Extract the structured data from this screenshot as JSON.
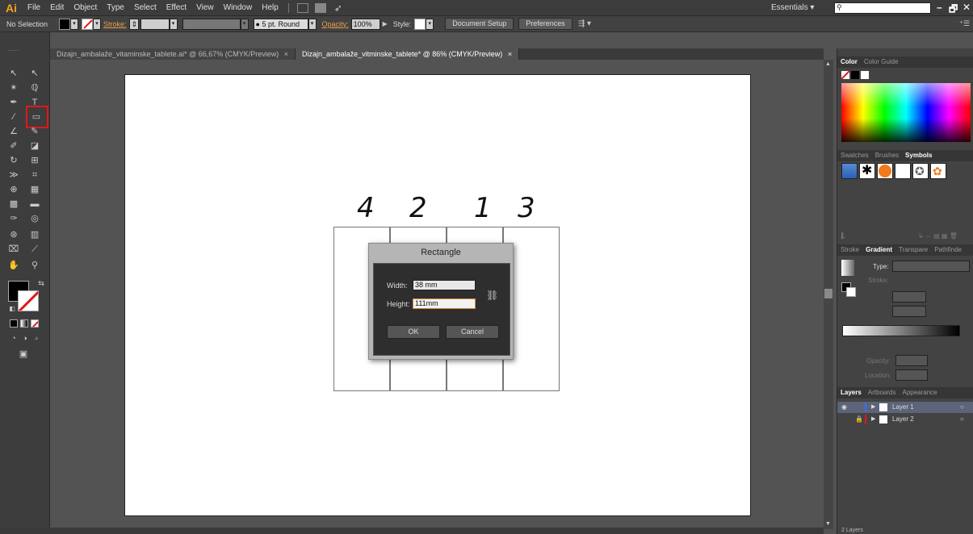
{
  "menubar": {
    "logo": "Ai",
    "items": [
      "File",
      "Edit",
      "Object",
      "Type",
      "Select",
      "Effect",
      "View",
      "Window",
      "Help"
    ],
    "workspace": "Essentials",
    "controls": [
      "–",
      "🗗",
      "✕"
    ]
  },
  "optbar": {
    "selection": "No Selection",
    "stroke_label": "Stroke:",
    "brush": "5 pt. Round",
    "opacity_label": "Opacity:",
    "opacity_value": "100%",
    "style_label": "Style:",
    "document_setup": "Document Setup",
    "preferences": "Preferences"
  },
  "tabs": [
    {
      "label": "Dizajn_ambalaže_vitaminske_tablete.ai* @ 66,67% (CMYK/Preview)",
      "close": "×"
    },
    {
      "label": "Dizajn_ambalaže_vitminske_tablete* @ 86% (CMYK/Preview)",
      "close": "×"
    }
  ],
  "artboard": {
    "digits": [
      "4",
      "2",
      "1",
      "3"
    ]
  },
  "dialog": {
    "title": "Rectangle",
    "width_label": "Width:",
    "width_value": "38 mm",
    "height_label": "Height:",
    "height_value": "111mm",
    "ok": "OK",
    "cancel": "Cancel"
  },
  "panels": {
    "color_tabs": [
      "Color",
      "Color Guide"
    ],
    "swatch_tabs": [
      "Swatches",
      "Brushes",
      "Symbols"
    ],
    "gradient_tabs": [
      "Stroke",
      "Gradient",
      "Transpare",
      "Pathfinde"
    ],
    "type_label": "Type:",
    "stroke_label": "Stroke:",
    "opacity_label": "Opacity:",
    "location_label": "Location:",
    "layer_tabs": [
      "Layers",
      "Artboards",
      "Appearance"
    ],
    "layers": [
      "Layer 1",
      "Layer 2"
    ],
    "layer_count": "2 Layers"
  },
  "colors": {
    "accent": "#f7a21d",
    "highlight": "#e01818"
  }
}
